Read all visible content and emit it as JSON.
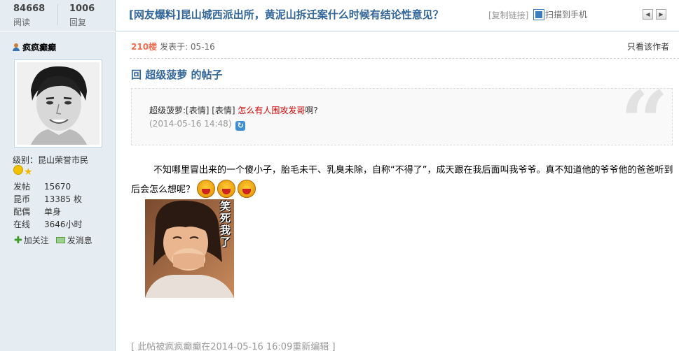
{
  "header": {
    "stats": [
      {
        "value": "84668",
        "label": "阅读"
      },
      {
        "value": "1006",
        "label": "回复"
      }
    ],
    "title": "[网友爆料]昆山城西派出所，黄泥山拆迁案什么时候有结论性意见？",
    "copy_link": "[复制链接]",
    "qr_label": "扫描到手机",
    "prev_label": "◀",
    "next_label": "▶"
  },
  "author": {
    "name": "疯疯癫癫",
    "level": "级别：昆山荣誉市民",
    "info": [
      {
        "key": "发帖",
        "value": "15670"
      },
      {
        "key": "昆币",
        "value": "13385 枚"
      },
      {
        "key": "配偶",
        "value": "单身"
      },
      {
        "key": "在线",
        "value": "3646小时"
      }
    ],
    "follow_label": "加关注",
    "message_label": "发消息"
  },
  "post": {
    "floor": "210楼",
    "posted_at": "发表于: 05-16",
    "only_author": "只看该作者",
    "reply_title": "回 超级菠萝 的帖子",
    "quote_prefix": "超级菠萝:[表情] [表情] ",
    "quote_red": "怎么有人围攻发哥",
    "quote_suffix": "啊?",
    "quote_time": "(2014-05-16 14:48)",
    "body": "不知哪里冒出来的一个傻小子，胎毛未干、乳臭未除，自称“不得了”，成天跟在我后面叫我爷爷。真不知道他的爷爷他的爸爸听到后会怎么想呢？",
    "image_caption": "笑死我了",
    "edit_note": "[ 此帖被疯疯癫癫在2014-05-16 16:09重新编辑 ]"
  },
  "colors": {
    "sidebar_bg": "#e5edf2",
    "title_blue": "#336699",
    "floor_orange": "#f26c4f",
    "quote_red": "#cc0000"
  }
}
